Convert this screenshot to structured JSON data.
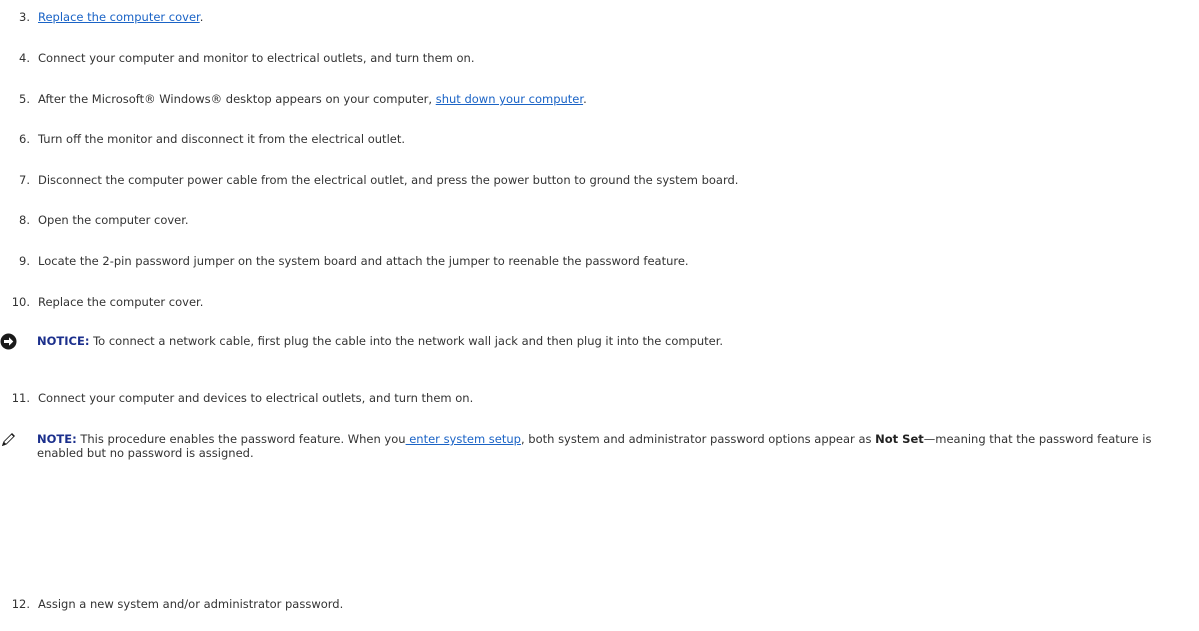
{
  "steps": [
    {
      "num": "3.",
      "parts": [
        {
          "link": "Replace the computer cover"
        },
        {
          "text": "."
        }
      ]
    },
    {
      "num": "4.",
      "parts": [
        {
          "text": "Connect your computer and monitor to electrical outlets, and turn them on."
        }
      ]
    },
    {
      "num": "5.",
      "parts": [
        {
          "text": "After the Microsoft® Windows® desktop appears on your computer, "
        },
        {
          "link": "shut down your computer"
        },
        {
          "text": "."
        }
      ]
    },
    {
      "num": "6.",
      "parts": [
        {
          "text": "Turn off the monitor and disconnect it from the electrical outlet."
        }
      ]
    },
    {
      "num": "7.",
      "parts": [
        {
          "text": "Disconnect the computer power cable from the electrical outlet, and press the power button to ground the system board."
        }
      ]
    },
    {
      "num": "8.",
      "parts": [
        {
          "text": "Open the computer cover."
        }
      ]
    },
    {
      "num": "9.",
      "parts": [
        {
          "text": "Locate the 2-pin password jumper on the system board and attach the jumper to reenable the password feature."
        }
      ]
    },
    {
      "num": "10.",
      "parts": [
        {
          "text": "Replace the computer cover."
        }
      ]
    },
    {
      "num": "11.",
      "parts": [
        {
          "text": "Connect your computer and devices to electrical outlets, and turn them on."
        }
      ]
    },
    {
      "num": "12.",
      "parts": [
        {
          "text": "Assign a new system and/or administrator password."
        }
      ]
    }
  ],
  "notice": {
    "label": "NOTICE:",
    "text": " To connect a network cable, first plug the cable into the network wall jack and then plug it into the computer."
  },
  "note": {
    "label": "NOTE:",
    "text1": " This procedure enables the password feature. When you",
    "link": " enter system setup",
    "text2": ", both system and administrator password options appear as ",
    "bold": "Not Set",
    "text3": "—meaning that the password feature is enabled but no password is assigned."
  },
  "colors": {
    "link": "#1a63c6",
    "label": "#1b2f8c",
    "text": "#333333"
  },
  "icons": {
    "notice": "notice-circle-arrow-icon",
    "note": "pencil-note-icon"
  }
}
